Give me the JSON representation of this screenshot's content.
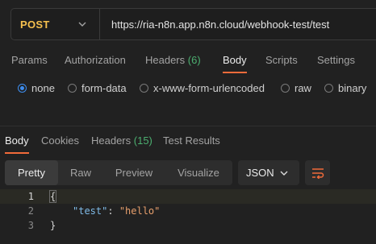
{
  "request": {
    "method": "POST",
    "url": "https://ria-n8n.app.n8n.cloud/webhook-test/test"
  },
  "request_tabs": [
    {
      "label": "Params"
    },
    {
      "label": "Authorization"
    },
    {
      "label": "Headers",
      "count": "(6)"
    },
    {
      "label": "Body",
      "active": true
    },
    {
      "label": "Scripts"
    },
    {
      "label": "Settings"
    }
  ],
  "body_types": [
    {
      "label": "none",
      "selected": true
    },
    {
      "label": "form-data"
    },
    {
      "label": "x-www-form-urlencoded"
    },
    {
      "label": "raw"
    },
    {
      "label": "binary"
    }
  ],
  "response_tabs": [
    {
      "label": "Body",
      "active": true
    },
    {
      "label": "Cookies"
    },
    {
      "label": "Headers",
      "count": "(15)"
    },
    {
      "label": "Test Results"
    }
  ],
  "view_modes": [
    {
      "label": "Pretty",
      "active": true
    },
    {
      "label": "Raw"
    },
    {
      "label": "Preview"
    },
    {
      "label": "Visualize"
    }
  ],
  "format": "JSON",
  "response_body": {
    "lines": [
      {
        "number": "1",
        "brace": "{"
      },
      {
        "number": "2",
        "key": "\"test\"",
        "colon": ": ",
        "value": "\"hello\""
      },
      {
        "number": "3",
        "brace": "}"
      }
    ]
  },
  "colors": {
    "method": "#f5c04e",
    "active_tab_underline": "#f26b3a",
    "count": "#4caf70",
    "radio_selected": "#3d8ef0",
    "json_key": "#7fbbe8",
    "json_string": "#e8a06d"
  },
  "icons": {
    "method_dropdown": "chevron-down-icon",
    "format_dropdown": "chevron-down-icon",
    "wrap": "text-wrap-icon"
  }
}
